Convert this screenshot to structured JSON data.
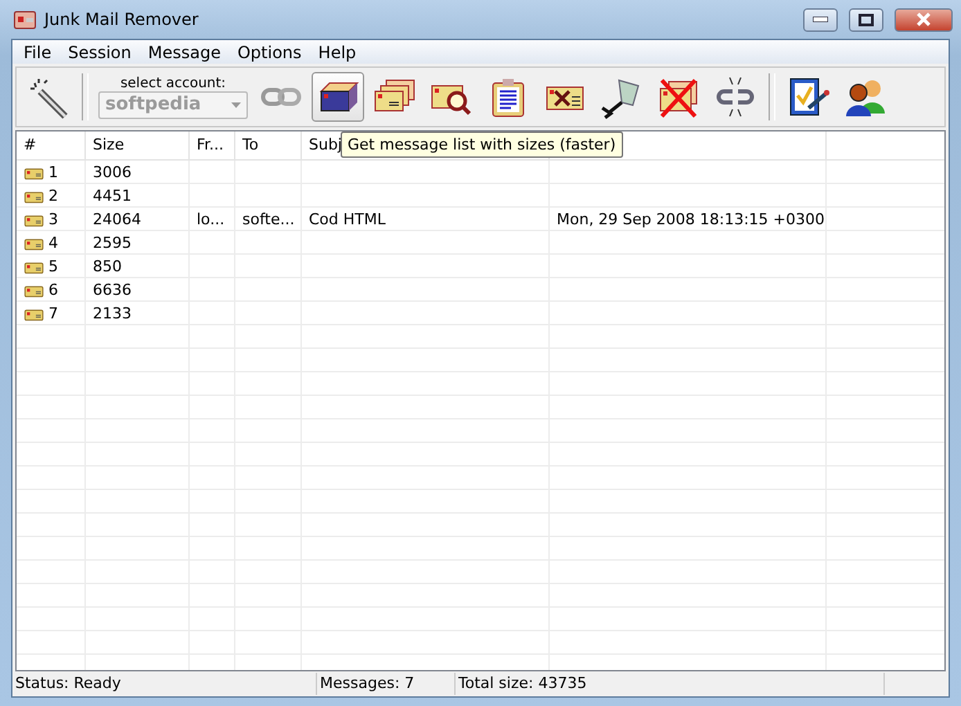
{
  "window": {
    "title": "Junk Mail Remover"
  },
  "menu": [
    "File",
    "Session",
    "Message",
    "Options",
    "Help"
  ],
  "toolbar": {
    "account_label": "select account:",
    "account": {
      "value": "softpedia",
      "disabled": true
    },
    "buttons": [
      {
        "kind": "wand",
        "hovered": false
      },
      {
        "kind": "connect",
        "hovered": false
      },
      {
        "kind": "boxes",
        "hovered": true
      },
      {
        "kind": "envelopes",
        "hovered": false
      },
      {
        "kind": "preview",
        "hovered": false
      },
      {
        "kind": "clipboard",
        "hovered": false
      },
      {
        "kind": "mark",
        "hovered": false
      },
      {
        "kind": "pin",
        "hovered": false
      },
      {
        "kind": "delete",
        "hovered": false
      },
      {
        "kind": "disconnect",
        "hovered": false
      },
      {
        "kind": "checklist",
        "hovered": false
      },
      {
        "kind": "users",
        "hovered": false
      }
    ],
    "tooltip": "Get message list with sizes (faster)"
  },
  "table": {
    "columns": [
      "#",
      "Size",
      "Fr...",
      "To",
      "Subj"
    ],
    "rows": [
      {
        "number": "1",
        "size": "3006"
      },
      {
        "number": "2",
        "size": "4451"
      },
      {
        "number": "3",
        "size": "24064",
        "from": "lo...",
        "to": "softe...",
        "subject": "Cod HTML",
        "date": "Mon, 29 Sep 2008 18:13:15 +0300"
      },
      {
        "number": "4",
        "size": "2595"
      },
      {
        "number": "5",
        "size": "850"
      },
      {
        "number": "6",
        "size": "6636"
      },
      {
        "number": "7",
        "size": "2133"
      }
    ]
  },
  "status_bar": [
    "Status: Ready",
    "Messages: 7",
    "Total size: 43735"
  ]
}
